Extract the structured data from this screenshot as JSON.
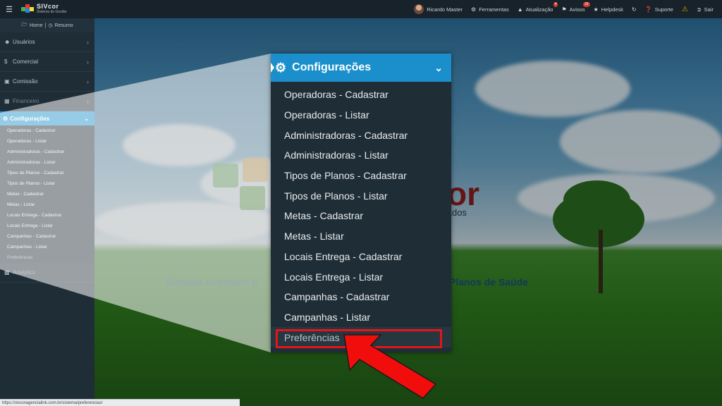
{
  "app": {
    "name": "SIVcor",
    "subtitle": "Sistema de Gestão"
  },
  "topbar": {
    "user": "Ricardo Master",
    "items": [
      {
        "label": "Ferramentas",
        "icon": "wrench-icon"
      },
      {
        "label": "Atualização",
        "icon": "warning-icon",
        "badge": "4"
      },
      {
        "label": "Avisos",
        "icon": "bell-icon",
        "badge": "33"
      },
      {
        "label": "Helpdesk",
        "icon": "helpdesk-icon"
      },
      {
        "label": "Suporte",
        "icon": "question-icon"
      },
      {
        "label": "Sair",
        "icon": "logout-icon"
      }
    ]
  },
  "sidebar": {
    "home": "Home",
    "resumo": "Resumo",
    "items": [
      {
        "label": "Usuários",
        "icon": "users-icon"
      },
      {
        "label": "Comercial",
        "icon": "dollar-icon"
      },
      {
        "label": "Comissão",
        "icon": "money-icon"
      },
      {
        "label": "Financeiro",
        "icon": "briefcase-icon"
      }
    ],
    "active": {
      "label": "Configurações",
      "icon": "gears-icon"
    },
    "submenu": [
      "Operadoras - Cadastrar",
      "Operadoras - Listar",
      "Administradoras - Cadastrar",
      "Administradoras - Listar",
      "Tipos de Planos - Cadastrar",
      "Tipos de Planos - Listar",
      "Metas - Cadastrar",
      "Metas - Listar",
      "Locais Entrega - Cadastrar",
      "Locais Entrega - Listar",
      "Campanhas - Cadastrar",
      "Campanhas - Listar",
      "Preferências"
    ],
    "after": {
      "label": "Analytics",
      "icon": "chart-icon"
    }
  },
  "background": {
    "brand": "or",
    "brand_sub": "ultados",
    "tagline_left": "Sistema completo p",
    "tagline_right": "Planos de Saúde"
  },
  "zoom": {
    "title": "Configurações",
    "items": [
      "Operadoras - Cadastrar",
      "Operadoras - Listar",
      "Administradoras - Cadastrar",
      "Administradoras - Listar",
      "Tipos de Planos - Cadastrar",
      "Tipos de Planos - Listar",
      "Metas - Cadastrar",
      "Metas - Listar",
      "Locais Entrega - Cadastrar",
      "Locais Entrega - Listar",
      "Campanhas - Cadastrar",
      "Campanhas - Listar"
    ],
    "highlighted": "Preferências"
  },
  "statusbar": {
    "url": "https://sivcoragencialink.com.br/sistema/preferencias/"
  },
  "colors": {
    "accent": "#1a8fcb",
    "highlight": "#e3161b",
    "sidebar": "#1f2d36"
  }
}
